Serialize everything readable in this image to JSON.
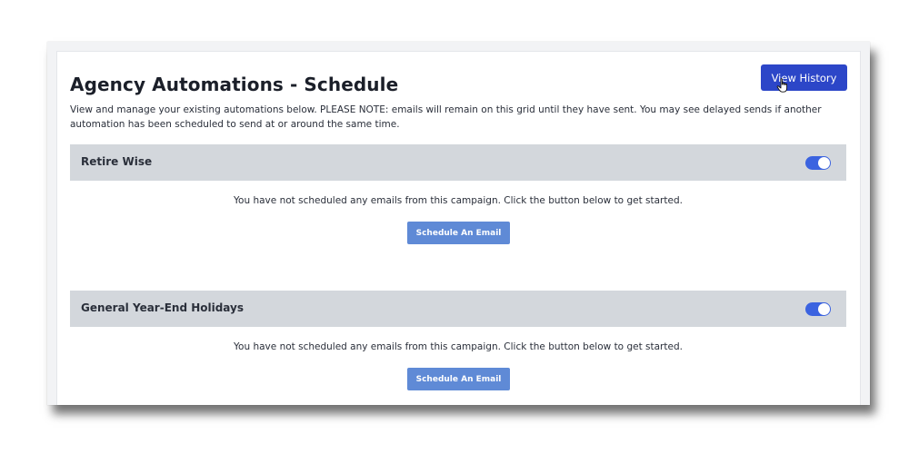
{
  "page": {
    "title": "Agency Automations - Schedule",
    "view_history_label": "View History",
    "intro": "View and manage your existing automations below. PLEASE NOTE: emails will remain on this grid until they have sent. You may see delayed sends if another automation has been scheduled to send at or around the same time."
  },
  "campaigns": [
    {
      "name": "Retire Wise",
      "enabled": true,
      "empty_message": "You have not scheduled any emails from this campaign. Click the button below to get started.",
      "button_label": "Schedule An Email"
    },
    {
      "name": "General Year-End Holidays",
      "enabled": true,
      "empty_message": "You have not scheduled any emails from this campaign. Click the button below to get started.",
      "button_label": "Schedule An Email"
    }
  ],
  "colors": {
    "primary_button": "#2c46c8",
    "schedule_button": "#5f8ad6",
    "section_header": "#d3d7dc",
    "toggle_on": "#3b63e0"
  },
  "icons": {
    "cursor": "hand-pointer-icon",
    "toggle": "toggle-on-icon"
  }
}
